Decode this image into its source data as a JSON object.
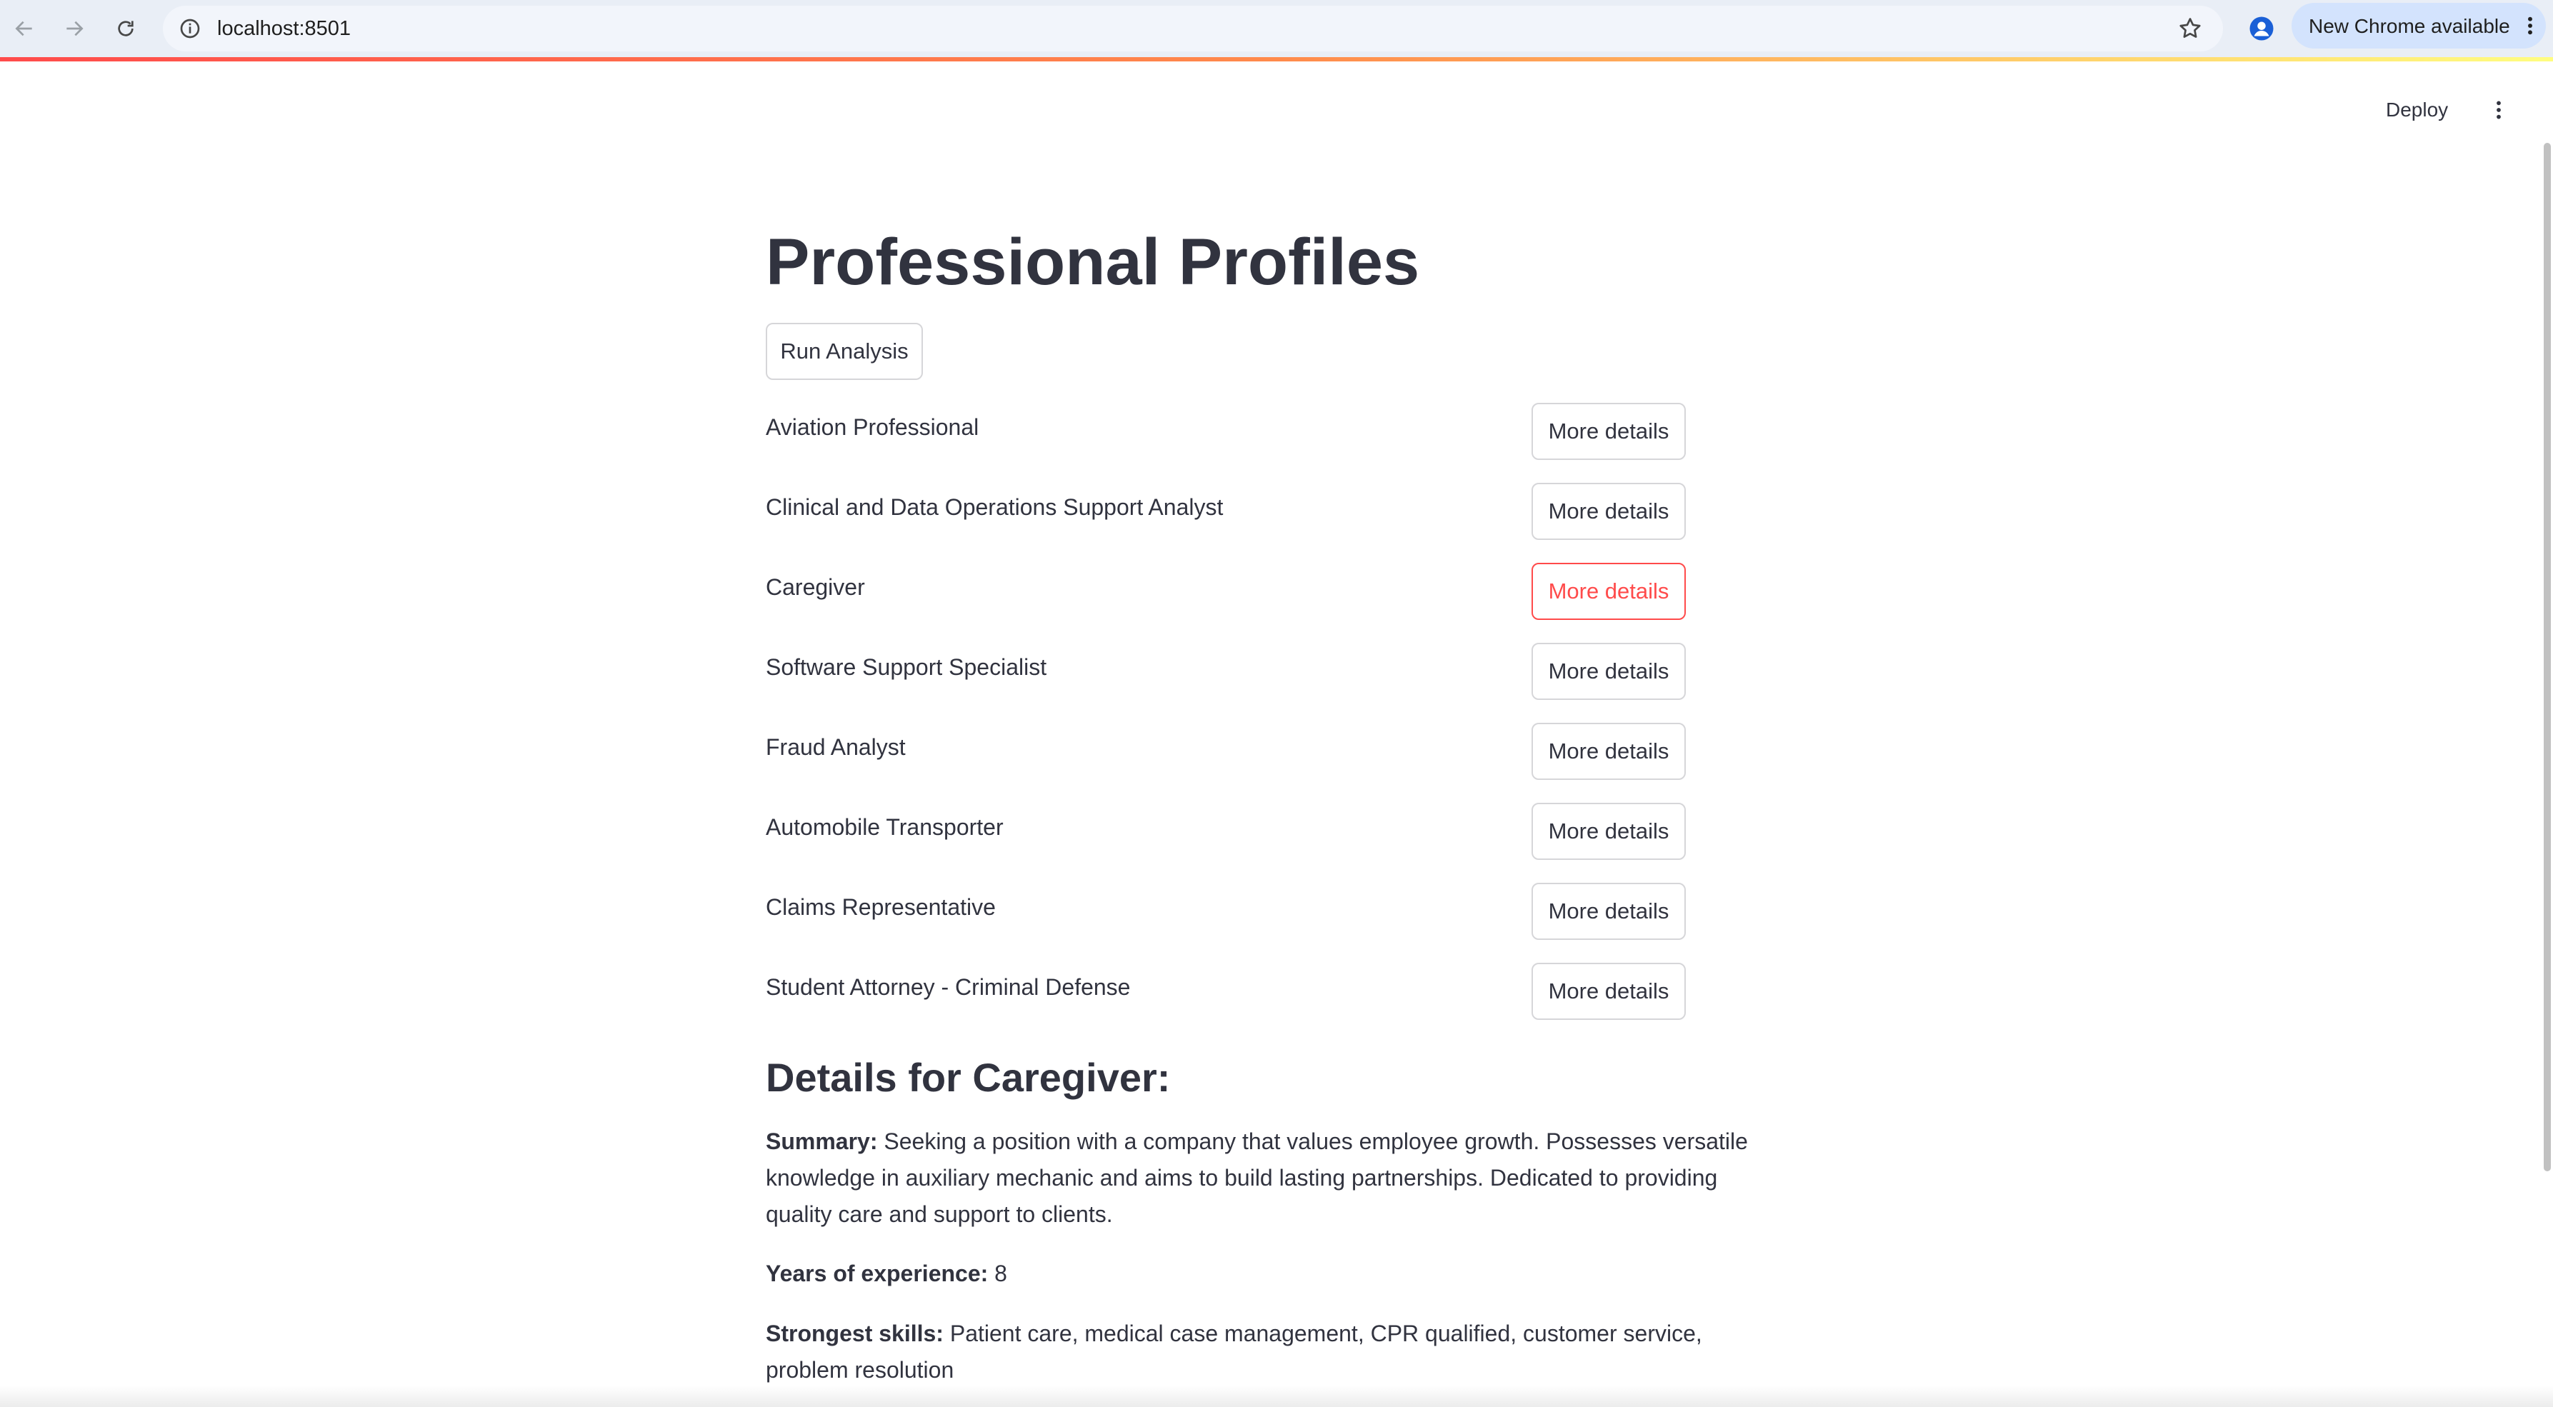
{
  "browser": {
    "url": "localhost:8501",
    "update_label": "New Chrome available",
    "icons": [
      "back-icon",
      "forward-icon",
      "reload-icon",
      "info-icon",
      "star-icon",
      "profile-icon",
      "more-vert-icon"
    ]
  },
  "app_header": {
    "deploy_label": "Deploy"
  },
  "page": {
    "title": "Professional Profiles",
    "run_button_label": "Run Analysis"
  },
  "profiles": [
    {
      "title": "Aviation Professional",
      "button_label": "More details",
      "active": false
    },
    {
      "title": "Clinical and Data Operations Support Analyst",
      "button_label": "More details",
      "active": false
    },
    {
      "title": "Caregiver",
      "button_label": "More details",
      "active": true
    },
    {
      "title": "Software Support Specialist",
      "button_label": "More details",
      "active": false
    },
    {
      "title": "Fraud Analyst",
      "button_label": "More details",
      "active": false
    },
    {
      "title": "Automobile Transporter",
      "button_label": "More details",
      "active": false
    },
    {
      "title": "Claims Representative",
      "button_label": "More details",
      "active": false
    },
    {
      "title": "Student Attorney - Criminal Defense",
      "button_label": "More details",
      "active": false
    }
  ],
  "details": {
    "heading": "Details for Caregiver:",
    "summary_label": "Summary:",
    "summary_text": "Seeking a position with a company that values employee growth. Possesses versatile knowledge in auxiliary mechanic and aims to build lasting partnerships. Dedicated to providing quality care and support to clients.",
    "experience_label": "Years of experience:",
    "experience_value": "8",
    "skills_label": "Strongest skills:",
    "skills_text": "Patient care, medical case management, CPR qualified, customer service, problem resolution"
  },
  "colors": {
    "accent": "#ff4b4b",
    "text": "#31333f",
    "chrome_bg": "#e9eef6",
    "update_pill": "#d3e3fd"
  }
}
